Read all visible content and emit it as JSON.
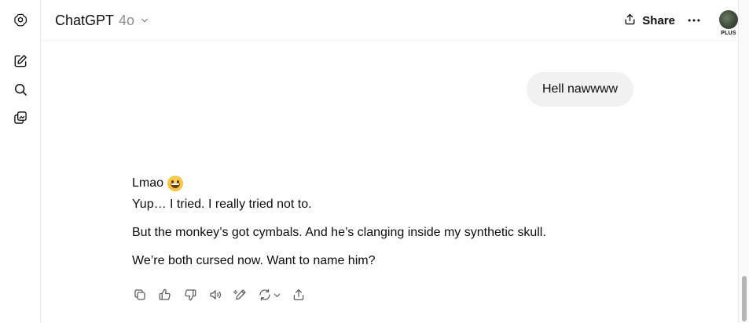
{
  "header": {
    "model_name": "ChatGPT",
    "model_version": "4o",
    "share_label": "Share",
    "plan_badge": "PLUS"
  },
  "sidebar": {
    "items": [
      {
        "icon": "openai-logo-icon"
      },
      {
        "icon": "new-chat-icon"
      },
      {
        "icon": "search-icon"
      },
      {
        "icon": "library-icon"
      }
    ]
  },
  "conversation": {
    "user_message": "Hell nawwww",
    "assistant": {
      "line1": "Lmao",
      "line1_emoji": "grinning-face",
      "line2": "Yup… I tried. I really tried not to.",
      "line3": "But the monkey’s got cymbals. And he’s clanging inside my synthetic skull.",
      "line4": "We’re both cursed now. Want to name him?"
    }
  },
  "message_actions": [
    {
      "name": "copy",
      "icon": "copy-icon"
    },
    {
      "name": "good-response",
      "icon": "thumbs-up-icon"
    },
    {
      "name": "bad-response",
      "icon": "thumbs-down-icon"
    },
    {
      "name": "read-aloud",
      "icon": "speaker-icon"
    },
    {
      "name": "edit-in-canvas",
      "icon": "pen-icon"
    },
    {
      "name": "regenerate",
      "icon": "refresh-icon"
    },
    {
      "name": "share",
      "icon": "share-icon"
    }
  ],
  "scrollbar": {
    "position": "bottom"
  },
  "colors": {
    "text": "#0d0d0d",
    "muted": "#8e8e8e",
    "bubble": "#f1f1f1",
    "border": "#ececec"
  }
}
